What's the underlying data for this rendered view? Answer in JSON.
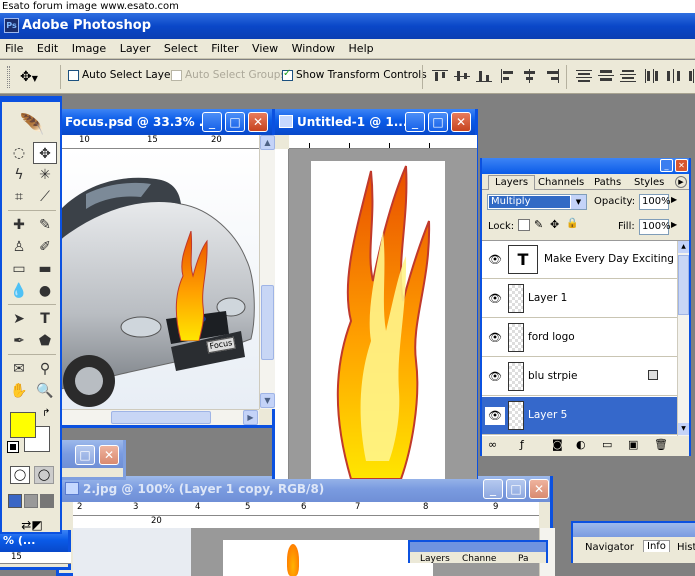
{
  "banner": "Esato forum image www.esato.com",
  "app": {
    "title": "Adobe Photoshop",
    "icon": "Ps"
  },
  "menu": [
    "File",
    "Edit",
    "Image",
    "Layer",
    "Select",
    "Filter",
    "View",
    "Window",
    "Help"
  ],
  "options": {
    "auto_select_layer": "Auto Select Layer",
    "auto_select_groups": "Auto Select Groups",
    "show_transform_controls": "Show Transform Controls"
  },
  "windows": {
    "focus": {
      "title": "Focus.psd @ 33.3% ...",
      "ruler": [
        "10",
        "15",
        "20"
      ],
      "badge": "Focus"
    },
    "untitled": {
      "title": "Untitled-1 @ 1..."
    },
    "jpg2": {
      "title": "2.jpg @ 100% (Layer 1 copy, RGB/8)",
      "ruler": [
        "2",
        "3",
        "4",
        "5",
        "6",
        "7",
        "8",
        "9"
      ],
      "ruler2": [
        "20"
      ]
    },
    "small": {
      "title": "% (...",
      "ruler": [
        "15"
      ]
    }
  },
  "layers_panel": {
    "tabs": [
      "Layers",
      "Channels",
      "Paths",
      "Styles"
    ],
    "blend_mode": "Multiply",
    "opacity_label": "Opacity:",
    "opacity": "100%",
    "lock_label": "Lock:",
    "fill_label": "Fill:",
    "fill": "100%",
    "layers": [
      {
        "name": "Make Every Day Exciting",
        "type": "text",
        "glyph": "T"
      },
      {
        "name": "Layer 1",
        "type": "raster"
      },
      {
        "name": "ford logo",
        "type": "raster"
      },
      {
        "name": "blu strpie",
        "type": "raster",
        "locked": true
      },
      {
        "name": "Layer 5",
        "type": "raster",
        "selected": true
      }
    ]
  },
  "info_panel": {
    "tabs": [
      "Navigator",
      "Info",
      "Hist"
    ]
  },
  "bottom_panel": {
    "tabs": [
      "Layers",
      "Channe",
      "Pa"
    ]
  },
  "colors": {
    "foreground": "#ffff00",
    "background": "#ffffff",
    "title_blue": "#0a5be8"
  }
}
